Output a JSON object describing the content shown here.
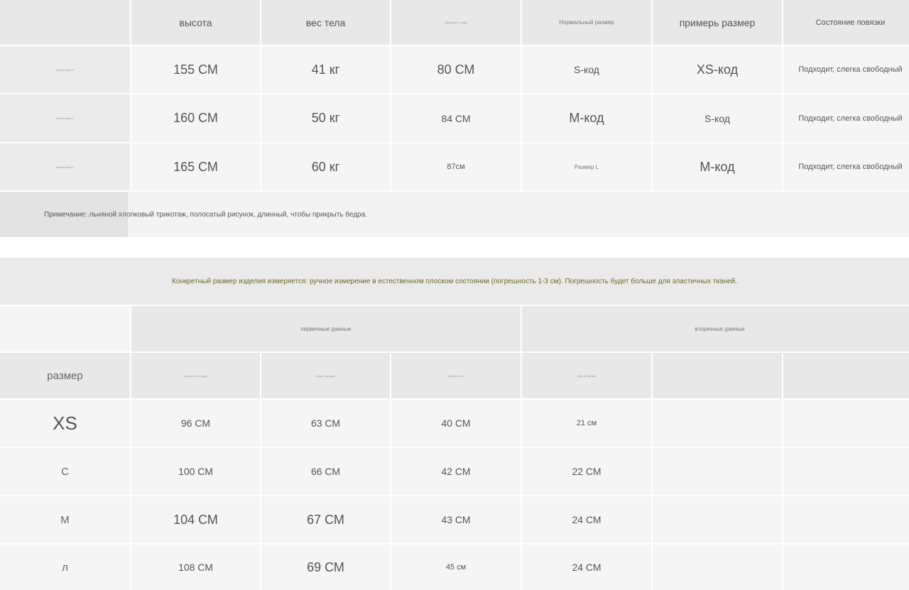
{
  "table1": {
    "headers": [
      "",
      "высота",
      "вес тела",
      "окружность груди",
      "Нормальный размер",
      "примерь размер",
      "Состояние повязки"
    ],
    "rows": [
      [
        "Маленькая A",
        "155 СМ",
        "41 кг",
        "80 СМ",
        "S-код",
        "XS-код",
        "Подходит, слегка свободный"
      ],
      [
        "Маленькая Б",
        "160 СМ",
        "50 кг",
        "84 СМ",
        "М-код",
        "S-код",
        "Подходит, слегка свободный"
      ],
      [
        "Маленький С",
        "165 СМ",
        "60 кг",
        "87см",
        "Размер L",
        "М-код",
        "Подходит, слегка свободный"
      ]
    ],
    "note": "Примечание: льняной хлопковый трикотаж, полосатый рисунок, длинный, чтобы прикрыть бедра."
  },
  "banner": "Конкретный размер изделия измеряется: ручное измерение в естественном плоском состоянии (погрешность 1-3 см). Погрешность будет больше для эластичных тканей.",
  "table2": {
    "group_headers": {
      "primary": "первичные данные",
      "secondary": "вторичные данные"
    },
    "column_headers": [
      "размер",
      "окружность груди",
      "длина одежды",
      "ширина плеч",
      "Длина Рукава",
      "",
      ""
    ],
    "rows": [
      [
        "XS",
        "96 СМ",
        "63 СМ",
        "40 СМ",
        "21 см",
        "",
        ""
      ],
      [
        "С",
        "100 СМ",
        "66 СМ",
        "42 СМ",
        "22 СМ",
        "",
        ""
      ],
      [
        "М",
        "104 СМ",
        "67 СМ",
        "43 СМ",
        "24 СМ",
        "",
        ""
      ],
      [
        "л",
        "108 СМ",
        "69 СМ",
        "45 см",
        "24 СМ",
        "",
        ""
      ]
    ]
  }
}
